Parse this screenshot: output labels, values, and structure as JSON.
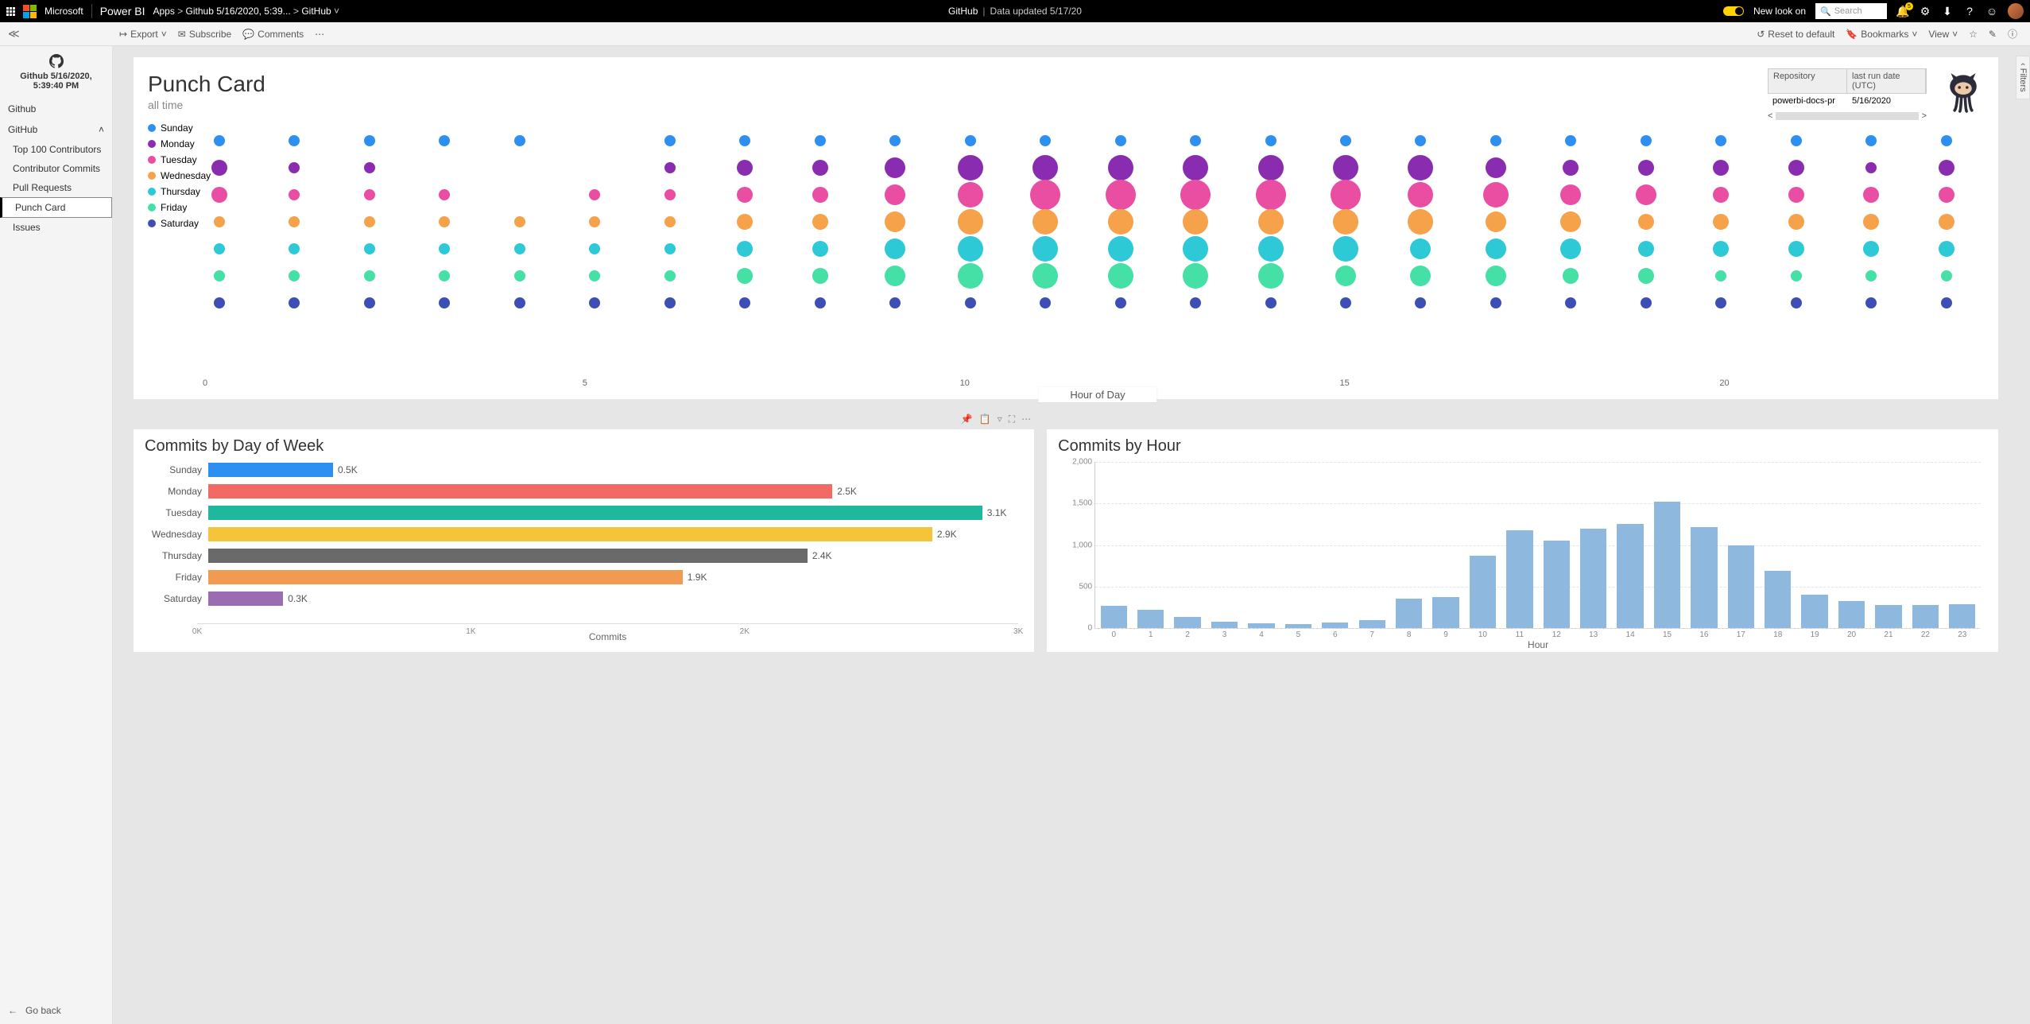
{
  "topbar": {
    "microsoft": "Microsoft",
    "product": "Power BI",
    "crumbs": [
      "Apps",
      "Github 5/16/2020, 5:39...",
      "GitHub"
    ],
    "center_app": "GitHub",
    "center_updated": "Data updated 5/17/20",
    "new_look": "New look on",
    "search_placeholder": "Search",
    "bell_count": "5"
  },
  "toolbar": {
    "export": "Export",
    "subscribe": "Subscribe",
    "comments": "Comments",
    "reset": "Reset to default",
    "bookmarks": "Bookmarks",
    "view": "View"
  },
  "nav": {
    "timestamp": "Github 5/16/2020, 5:39:40 PM",
    "root": "Github",
    "parent": "GitHub",
    "subs": [
      "Top 100 Contributors",
      "Contributor Commits",
      "Pull Requests",
      "Punch Card",
      "Issues"
    ],
    "active": "Punch Card",
    "goback": "Go back"
  },
  "filters_label": "Filters",
  "punch": {
    "title": "Punch Card",
    "subtitle": "all time",
    "repo_header": [
      "Repository",
      "last run date (UTC)"
    ],
    "repo_row": [
      "powerbi-docs-pr",
      "5/16/2020"
    ],
    "legend": [
      "Sunday",
      "Monday",
      "Tuesday",
      "Wednesday",
      "Thursday",
      "Friday",
      "Saturday"
    ],
    "colors": [
      "#2f8ff0",
      "#8a2cb0",
      "#e94ea3",
      "#f5a24a",
      "#2ec9d6",
      "#44e0a6",
      "#3d4fb5"
    ],
    "xlabel": "Hour of Day",
    "xticks": [
      0,
      5,
      10,
      15,
      20
    ]
  },
  "commits_day": {
    "title": "Commits by Day of Week",
    "xlabel": "Commits",
    "xticks": [
      "0K",
      "1K",
      "2K",
      "3K"
    ]
  },
  "commits_hour": {
    "title": "Commits by Hour",
    "xlabel": "Hour",
    "yticks": [
      "0",
      "500",
      "1,000",
      "1,500",
      "2,000"
    ]
  },
  "chart_data": [
    {
      "type": "scatter",
      "name": "punch_card",
      "title": "Punch Card",
      "xlabel": "Hour of Day",
      "x": [
        0,
        1,
        2,
        3,
        4,
        5,
        6,
        7,
        8,
        9,
        10,
        11,
        12,
        13,
        14,
        15,
        16,
        17,
        18,
        19,
        20,
        21,
        22,
        23
      ],
      "series": [
        {
          "name": "Sunday",
          "color": "#2f8ff0",
          "sizes": [
            2,
            2,
            2,
            2,
            2,
            0,
            2,
            2,
            2,
            2,
            2,
            2,
            2,
            2,
            2,
            2,
            2,
            2,
            2,
            2,
            2,
            2,
            2,
            2
          ]
        },
        {
          "name": "Monday",
          "color": "#8a2cb0",
          "sizes": [
            3,
            2,
            2,
            0,
            0,
            0,
            2,
            3,
            3,
            4,
            5,
            5,
            5,
            5,
            5,
            5,
            5,
            4,
            3,
            3,
            3,
            3,
            2,
            3
          ]
        },
        {
          "name": "Tuesday",
          "color": "#e94ea3",
          "sizes": [
            3,
            2,
            2,
            2,
            0,
            2,
            2,
            3,
            3,
            4,
            5,
            6,
            6,
            6,
            6,
            6,
            5,
            5,
            4,
            4,
            3,
            3,
            3,
            3
          ]
        },
        {
          "name": "Wednesday",
          "color": "#f5a24a",
          "sizes": [
            2,
            2,
            2,
            2,
            2,
            2,
            2,
            3,
            3,
            4,
            5,
            5,
            5,
            5,
            5,
            5,
            5,
            4,
            4,
            3,
            3,
            3,
            3,
            3
          ]
        },
        {
          "name": "Thursday",
          "color": "#2ec9d6",
          "sizes": [
            2,
            2,
            2,
            2,
            2,
            2,
            2,
            3,
            3,
            4,
            5,
            5,
            5,
            5,
            5,
            5,
            4,
            4,
            4,
            3,
            3,
            3,
            3,
            3
          ]
        },
        {
          "name": "Friday",
          "color": "#44e0a6",
          "sizes": [
            2,
            2,
            2,
            2,
            2,
            2,
            2,
            3,
            3,
            4,
            5,
            5,
            5,
            5,
            5,
            4,
            4,
            4,
            3,
            3,
            2,
            2,
            2,
            2
          ]
        },
        {
          "name": "Saturday",
          "color": "#3d4fb5",
          "sizes": [
            2,
            2,
            2,
            2,
            2,
            2,
            2,
            2,
            2,
            2,
            2,
            2,
            2,
            2,
            2,
            2,
            2,
            2,
            2,
            2,
            2,
            2,
            2,
            2
          ]
        }
      ]
    },
    {
      "type": "bar",
      "name": "commits_by_day",
      "orientation": "horizontal",
      "title": "Commits by Day of Week",
      "xlabel": "Commits",
      "xlim": [
        0,
        3200
      ],
      "categories": [
        "Sunday",
        "Monday",
        "Tuesday",
        "Wednesday",
        "Thursday",
        "Friday",
        "Saturday"
      ],
      "values": [
        500,
        2500,
        3100,
        2900,
        2400,
        1900,
        300
      ],
      "labels": [
        "0.5K",
        "2.5K",
        "3.1K",
        "2.9K",
        "2.4K",
        "1.9K",
        "0.3K"
      ],
      "colors": [
        "#2e8ff3",
        "#f26a63",
        "#1fb89f",
        "#f5c43b",
        "#6a6a6a",
        "#f19a52",
        "#9a6db3"
      ]
    },
    {
      "type": "bar",
      "name": "commits_by_hour",
      "title": "Commits by Hour",
      "xlabel": "Hour",
      "ylim": [
        0,
        2000
      ],
      "categories": [
        0,
        1,
        2,
        3,
        4,
        5,
        6,
        7,
        8,
        9,
        10,
        11,
        12,
        13,
        14,
        15,
        16,
        17,
        18,
        19,
        20,
        21,
        22,
        23
      ],
      "values": [
        270,
        220,
        130,
        80,
        60,
        50,
        70,
        100,
        350,
        370,
        870,
        1180,
        1050,
        1200,
        1250,
        1520,
        1220,
        1000,
        690,
        400,
        330,
        280,
        280,
        290
      ],
      "color": "#8fb8de"
    }
  ]
}
